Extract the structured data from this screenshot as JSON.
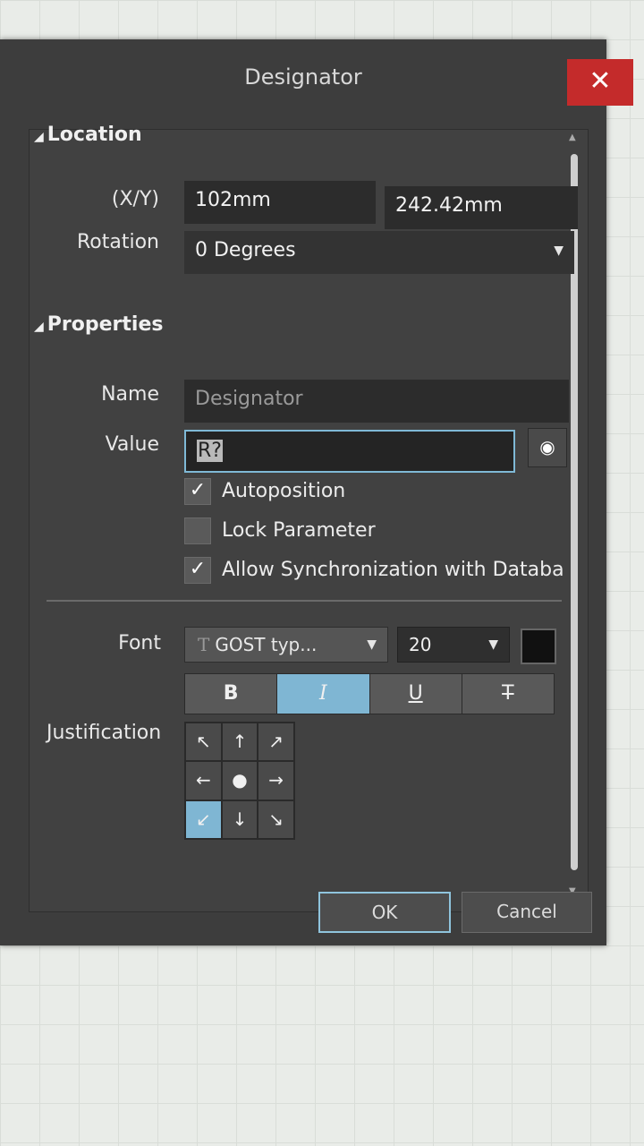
{
  "dialog": {
    "title": "Designator",
    "close_glyph": "✕",
    "ok_label": "OK",
    "cancel_label": "Cancel"
  },
  "location": {
    "header": "Location",
    "xy_label": "(X/Y)",
    "x_value": "102mm",
    "y_value": "242.42mm",
    "rotation_label": "Rotation",
    "rotation_value": "0 Degrees"
  },
  "properties": {
    "header": "Properties",
    "name_label": "Name",
    "name_value": "Designator",
    "value_label": "Value",
    "value_value": "R?",
    "autoposition_label": "Autoposition",
    "autoposition_checked": true,
    "lock_label": "Lock Parameter",
    "lock_checked": false,
    "sync_label": "Allow Synchronization with Databa",
    "sync_checked": true,
    "font_label": "Font",
    "font_family": "GOST typ...",
    "font_size": "20",
    "font_color": "#111111",
    "style_buttons": [
      "B",
      "I",
      "U",
      "T"
    ],
    "justification_label": "Justification",
    "justification_arrows": [
      "↖",
      "↑",
      "↗",
      "←",
      "●",
      "→",
      "↙",
      "↓",
      "↘"
    ],
    "justification_selected": "bottom-left"
  },
  "colors": {
    "accent": "#7fb6d3",
    "close": "#c42b2b",
    "dialog_bg": "#3d3d3d"
  }
}
